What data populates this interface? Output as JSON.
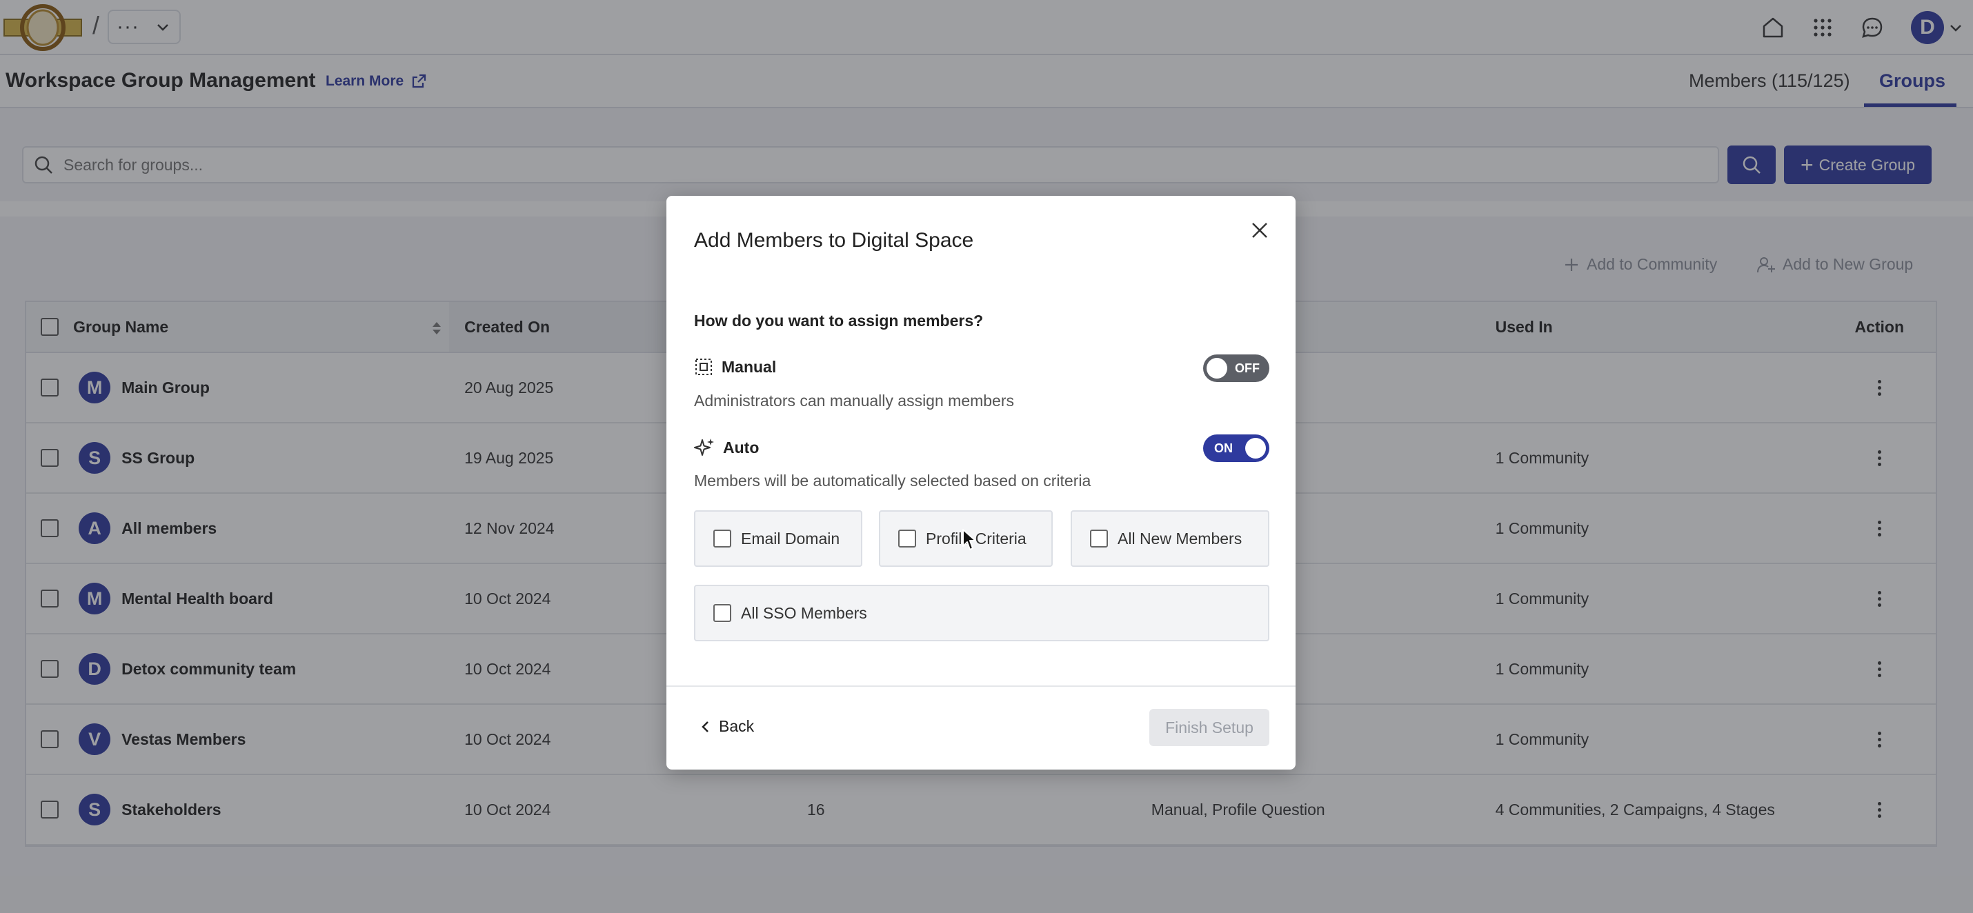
{
  "topbar": {
    "crumb_sep": "/",
    "crumb_menu_dots": "···",
    "avatar_initial": "D",
    "icons": [
      "home-icon",
      "apps-grid-icon",
      "chat-icon",
      "chevron-down-icon"
    ]
  },
  "header": {
    "title": "Workspace Group Management",
    "learn_more": "Learn More",
    "tabs": [
      {
        "label": "Members (115/125)",
        "active": false
      },
      {
        "label": "Groups",
        "active": true
      }
    ]
  },
  "search": {
    "placeholder": "Search for groups...",
    "value": "",
    "create_label": "Create Group"
  },
  "bulk_actions": {
    "add_to_community": "Add to Community",
    "add_to_new_group": "Add to New Group"
  },
  "table": {
    "columns": [
      "Group Name",
      "Created On",
      "",
      "",
      "Used In",
      "Action"
    ],
    "rows": [
      {
        "initial": "M",
        "name": "Main Group",
        "created": "20 Aug 2025",
        "members": "",
        "type": "",
        "used_in": ""
      },
      {
        "initial": "S",
        "name": "SS Group",
        "created": "19 Aug 2025",
        "members": "",
        "type": "",
        "used_in": "1 Community"
      },
      {
        "initial": "A",
        "name": "All members",
        "created": "12 Nov 2024",
        "members": "",
        "type": "",
        "used_in": "1 Community"
      },
      {
        "initial": "M",
        "name": "Mental Health board",
        "created": "10 Oct 2024",
        "members": "",
        "type": "",
        "used_in": "1 Community"
      },
      {
        "initial": "D",
        "name": "Detox community team",
        "created": "10 Oct 2024",
        "members": "",
        "type": "",
        "used_in": "1 Community"
      },
      {
        "initial": "V",
        "name": "Vestas Members",
        "created": "10 Oct 2024",
        "members": "",
        "type": "",
        "used_in": "1 Community"
      },
      {
        "initial": "S",
        "name": "Stakeholders",
        "created": "10 Oct 2024",
        "members": "16",
        "type": "Manual, Profile Question",
        "used_in": "4 Communities, 2 Campaigns, 4 Stages"
      }
    ]
  },
  "modal": {
    "title": "Add Members to Digital Space",
    "question": "How do you want to assign members?",
    "manual": {
      "label": "Manual",
      "description": "Administrators can manually assign members",
      "toggle_label": "OFF",
      "enabled": false
    },
    "auto": {
      "label": "Auto",
      "description": "Members will be automatically selected based on criteria",
      "toggle_label": "ON",
      "enabled": true
    },
    "criteria": [
      {
        "label": "Email Domain",
        "checked": false
      },
      {
        "label": "Profile Criteria",
        "checked": false
      },
      {
        "label": "All New Members",
        "checked": false
      },
      {
        "label": "All SSO Members",
        "checked": false
      }
    ],
    "back_label": "Back",
    "finish_label": "Finish Setup"
  },
  "colors": {
    "brand": "#2e3a9e",
    "toggle_off": "#5c5f66",
    "overlay": "rgba(40,42,48,0.45)"
  }
}
